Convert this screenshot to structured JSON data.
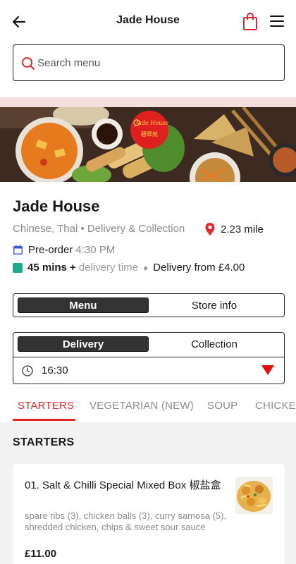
{
  "header": {
    "title": "Jade House",
    "back_icon": "arrow-left-icon",
    "bag_icon": "shopping-bag-icon",
    "menu_icon": "hamburger-menu-icon"
  },
  "search": {
    "placeholder": "Search menu",
    "value": ""
  },
  "hero": {
    "logo_text": "Jade House",
    "logo_cn": "碧翠苑"
  },
  "restaurant": {
    "name": "Jade House",
    "cuisine": "Chinese, Thai • Delivery & Collection",
    "distance": "2.23 mile",
    "preorder_label": "Pre-order",
    "preorder_time": "4:30 PM",
    "delivery_time_value": "45 mins +",
    "delivery_time_label": "delivery time",
    "delivery_fee": "Delivery from £4.00"
  },
  "view_toggle": {
    "options": [
      "Menu",
      "Store info"
    ],
    "selected": "Menu"
  },
  "order_type": {
    "options": [
      "Delivery",
      "Collection"
    ],
    "selected": "Delivery",
    "time": "16:30"
  },
  "category_tabs": [
    "STARTERS",
    "VEGETARIAN (NEW)",
    "SOUP",
    "CHICKEN"
  ],
  "active_tab": "STARTERS",
  "section": {
    "title": "STARTERS",
    "items": [
      {
        "name": "01. Salt & Chilli Special Mixed Box 椒盐盒",
        "description": "spare ribs (3), chicken balls (3), curry samosa (5), shredded chicken, chips & sweet sour sauce",
        "price": "£11.00"
      }
    ]
  },
  "colors": {
    "accent": "#e02828",
    "toggle_active": "#333333",
    "section_bg": "#f2f2f2",
    "band": "#f5dede"
  }
}
